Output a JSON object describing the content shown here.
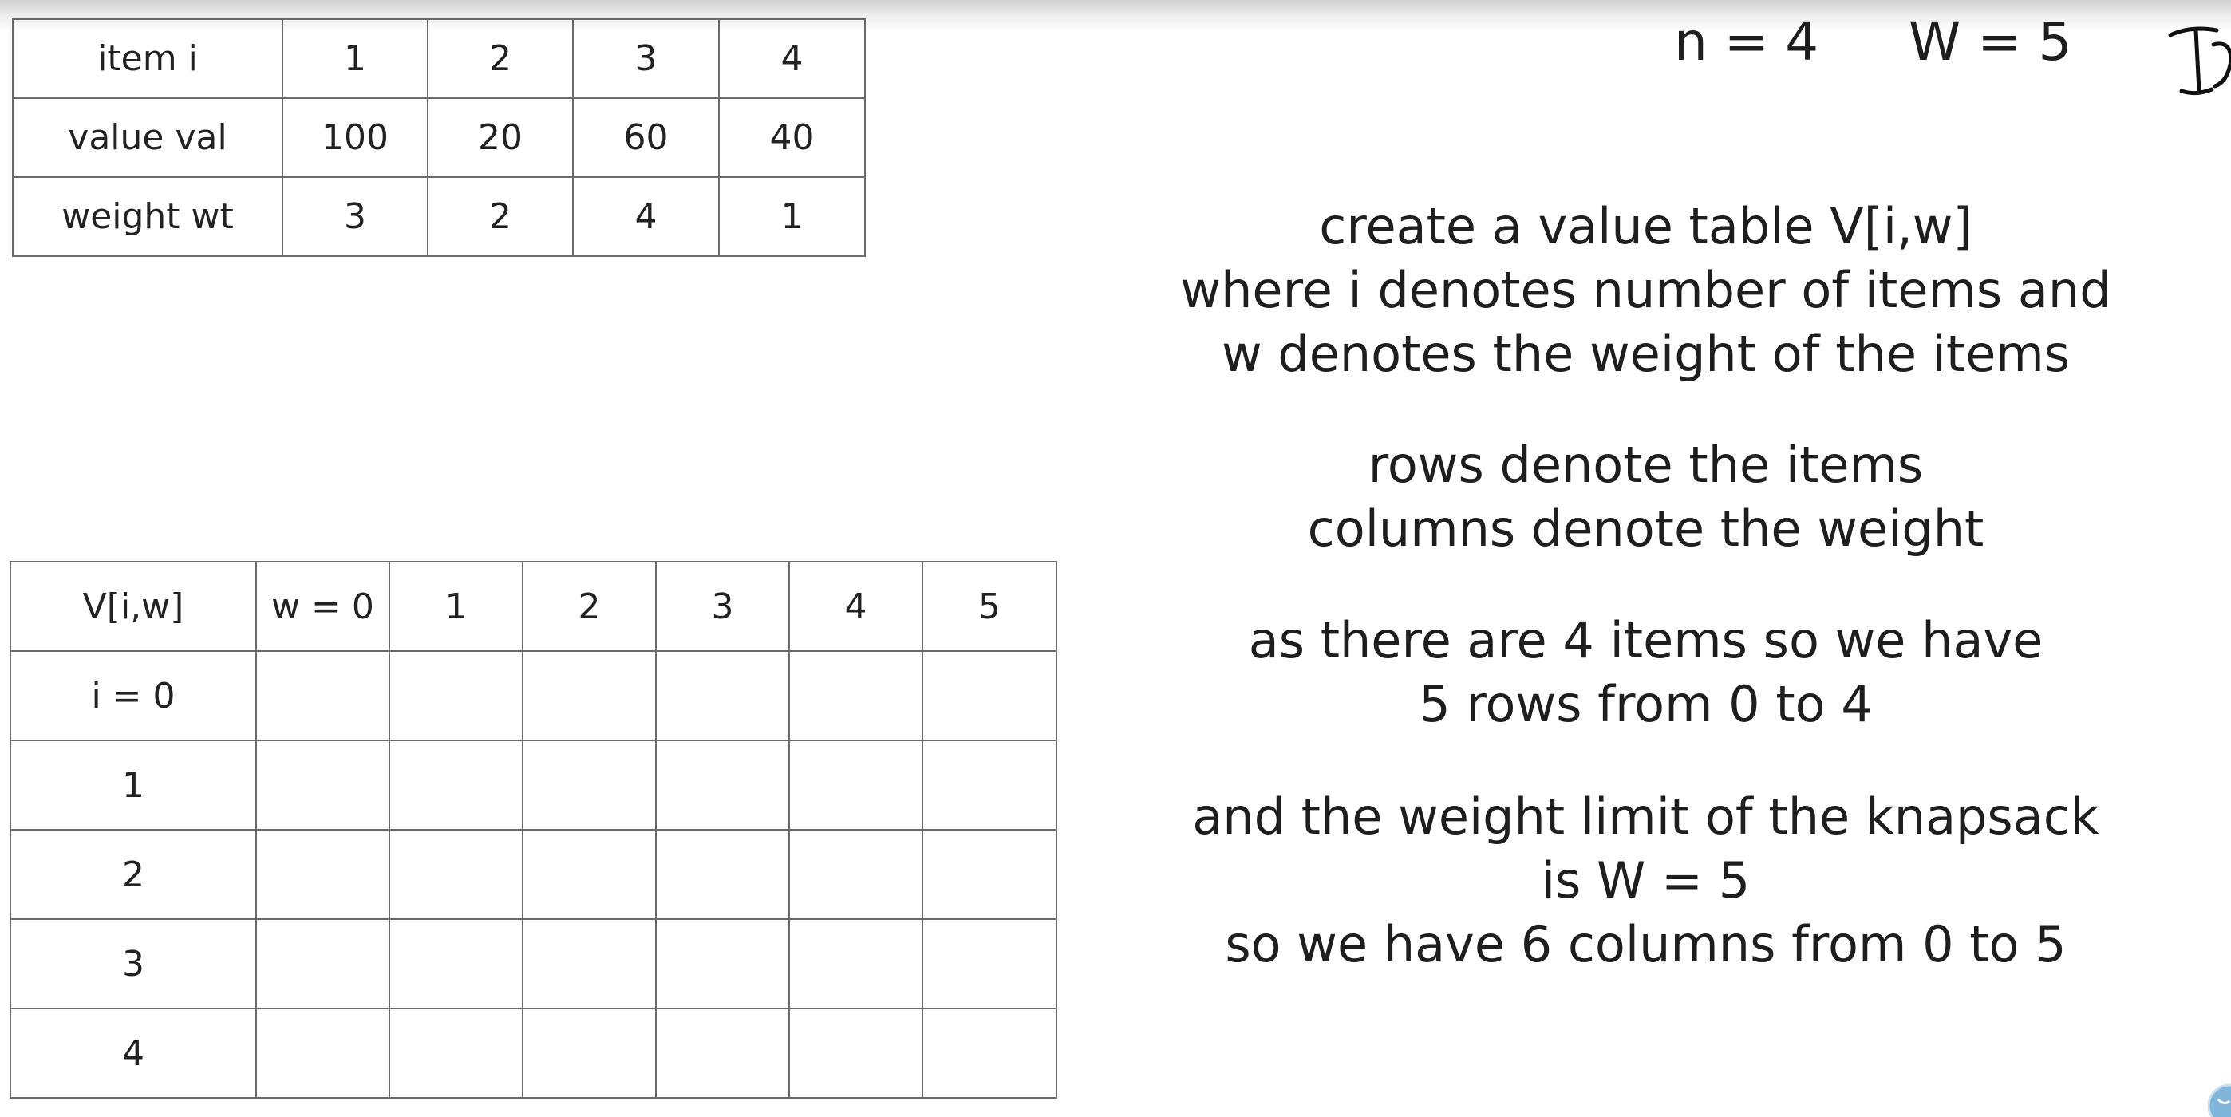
{
  "items_table": {
    "rows": [
      [
        "item i",
        "1",
        "2",
        "3",
        "4"
      ],
      [
        "value val",
        "100",
        "20",
        "60",
        "40"
      ],
      [
        "weight wt",
        "3",
        "2",
        "4",
        "1"
      ]
    ]
  },
  "params": {
    "n": "n = 4",
    "W": "W = 5"
  },
  "explanation": {
    "block1": [
      "create a value table V[i,w]",
      "where i denotes number of items and",
      "w denotes the weight of the items"
    ],
    "block2": [
      "rows denote the items",
      "columns denote the weight"
    ],
    "block3": [
      "as there are 4 items so we have",
      "5 rows from 0 to 4"
    ],
    "block4": [
      "and the weight limit of the knapsack",
      "is W = 5",
      "so we have 6 columns from 0 to 5"
    ]
  },
  "value_table": {
    "header": [
      "V[i,w]",
      "w = 0",
      "1",
      "2",
      "3",
      "4",
      "5"
    ],
    "row_labels": [
      "i = 0",
      "1",
      "2",
      "3",
      "4"
    ]
  }
}
